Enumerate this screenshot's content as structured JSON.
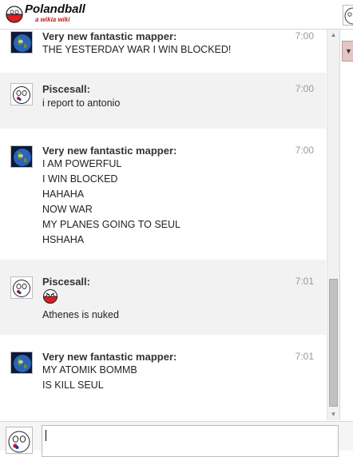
{
  "header": {
    "title": "Polandball",
    "subtitle": "a wikia wiki"
  },
  "messages": [
    {
      "user": "Very new fantastic mapper:",
      "time": "7:00",
      "avatar": "earth-avatar",
      "lines": [
        "THE YESTERDAY WAR I WIN BLOCKED!"
      ]
    },
    {
      "user": "Piscesall:",
      "time": "7:00",
      "avatar": "korea-ball-avatar",
      "lines": [
        "i report to antonio"
      ]
    },
    {
      "user": "Very new fantastic mapper:",
      "time": "7:00",
      "avatar": "earth-avatar",
      "lines": [
        "I AM POWERFUL",
        "I WIN BLOCKED",
        "HAHAHA",
        "NOW WAR",
        "MY PLANES GOING TO SEUL",
        "HSHAHA"
      ]
    },
    {
      "user": "Piscesall:",
      "time": "7:01",
      "avatar": "korea-ball-avatar",
      "emoji": "angry-polandball-emoticon",
      "lines": [
        "Athenes is nuked"
      ]
    },
    {
      "user": "Very new fantastic mapper:",
      "time": "7:01",
      "avatar": "earth-avatar",
      "lines": [
        "MY ATOMIK BOMMB",
        "IS KILL SEUL"
      ]
    }
  ],
  "input": {
    "value": "",
    "placeholder": ""
  },
  "colors": {
    "alt_row": "#f2f2f2",
    "subtitle_red": "#c51b1b",
    "time_gray": "#999999"
  }
}
